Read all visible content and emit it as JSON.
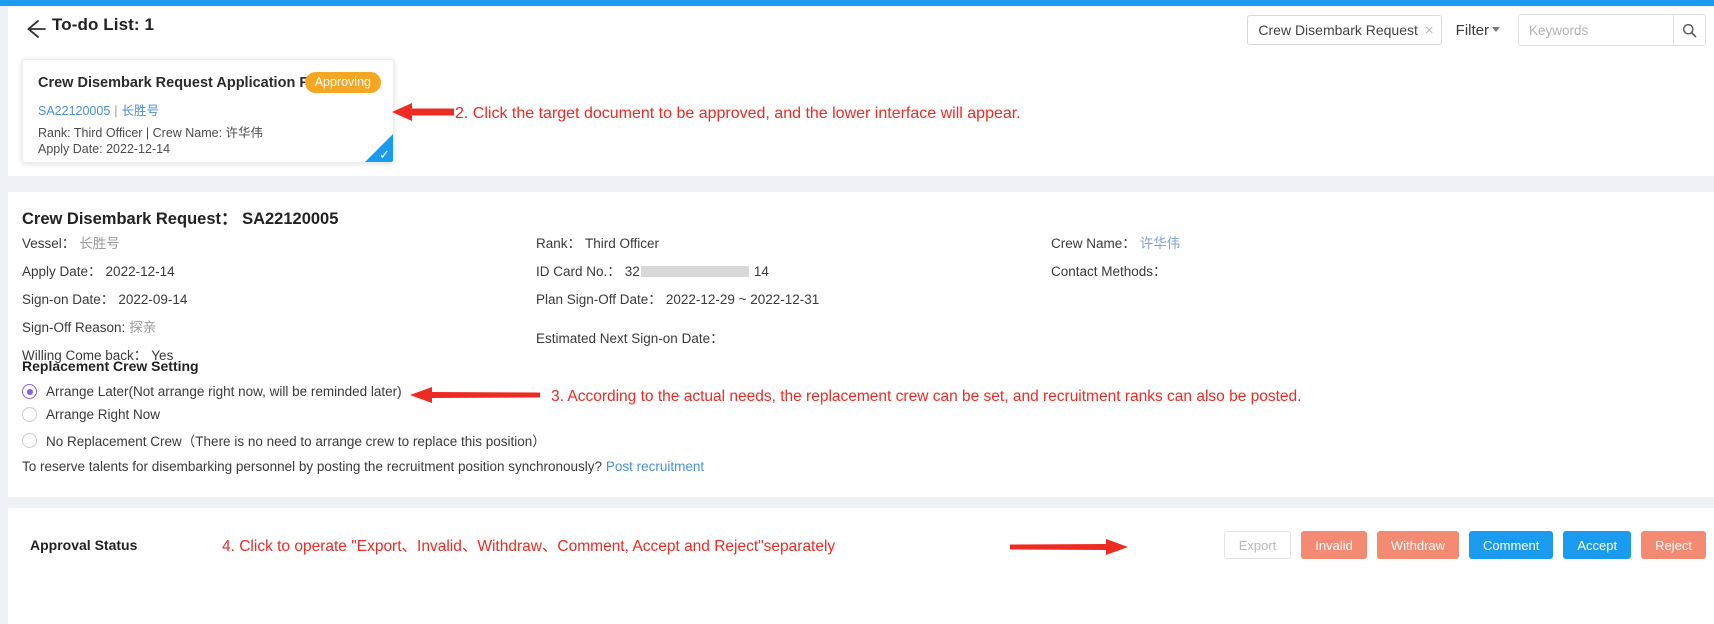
{
  "header": {
    "back_icon": "back-arrow-icon",
    "title": "To-do List: 1",
    "tag_chip": "Crew Disembark Request",
    "tag_chip_close": "×",
    "filter_label": "Filter",
    "search_placeholder": "Keywords",
    "search_value": "",
    "search_icon": "search-icon"
  },
  "todo_card": {
    "title": "Crew Disembark Request Application Form",
    "badge": "Approving",
    "doc_no": "SA22120005",
    "separator": "|",
    "vessel": "长胜号",
    "rank_line": "Rank: Third Officer | Crew Name: 许华伟",
    "apply_line": "Apply Date: 2022-12-14",
    "check_icon": "check-icon"
  },
  "detail": {
    "title": "Crew Disembark Request： SA22120005",
    "columns": [
      {
        "rows": [
          {
            "label": "Vessel：",
            "value": "长胜号",
            "style": "muted"
          },
          {
            "label": "Apply Date：",
            "value": "2022-12-14",
            "style": ""
          },
          {
            "label": "Sign-on Date：",
            "value": "2022-09-14",
            "style": ""
          },
          {
            "label": "Sign-Off Reason:",
            "value": "探亲",
            "style": "muted"
          },
          {
            "label": "Willing Come back：",
            "value": "Yes",
            "style": ""
          }
        ]
      },
      {
        "rows": [
          {
            "label": "Rank：",
            "value": "Third Officer",
            "style": ""
          },
          {
            "label": "ID Card No.：",
            "value": "32",
            "style": "redacted",
            "value_tail": "14"
          },
          {
            "label": "Plan Sign-Off Date：",
            "value": "2022-12-29 ~ 2022-12-31",
            "style": ""
          },
          {
            "label": "Estimated Next Sign-on Date：",
            "value": "",
            "style": "",
            "gap": true
          }
        ]
      },
      {
        "rows": [
          {
            "label": "Crew Name：",
            "value": "许华伟",
            "style": "link"
          },
          {
            "label": "Contact Methods：",
            "value": "",
            "style": ""
          }
        ]
      }
    ],
    "replacement_title": "Replacement Crew Setting",
    "radios": [
      {
        "label": "Arrange Later(Not arrange right now, will be reminded later)",
        "checked": true
      },
      {
        "label": "Arrange Right Now",
        "checked": false
      },
      {
        "label": "No Replacement Crew（There is no need to arrange crew to replace this position）",
        "checked": false
      }
    ],
    "recruit_text": "To reserve talents for disembarking personnel by posting the recruitment position synchronously?",
    "recruit_link": "Post recruitment"
  },
  "footer": {
    "approval_title": "Approval Status",
    "buttons": [
      {
        "label": "Export",
        "style": "ghost"
      },
      {
        "label": "Invalid",
        "style": "salmon"
      },
      {
        "label": "Withdraw",
        "style": "salmon"
      },
      {
        "label": "Comment",
        "style": "blue"
      },
      {
        "label": "Accept",
        "style": "blue"
      },
      {
        "label": "Reject",
        "style": "salmon"
      }
    ]
  },
  "annotations": {
    "step2": "2. Click the target document to be approved, and the lower interface will appear.",
    "step3": "3. According to the actual needs, the replacement crew can be set, and recruitment ranks can also be posted.",
    "step4": "4. Click to operate \"Export、Invalid、Withdraw、Comment, Accept and Reject\"separately"
  },
  "colors": {
    "accent_blue": "#1a9bf0",
    "badge_orange": "#f5a623",
    "annotation_red": "#ee2b23",
    "radio_purple": "#8b63d6",
    "salmon": "#f58a73"
  }
}
